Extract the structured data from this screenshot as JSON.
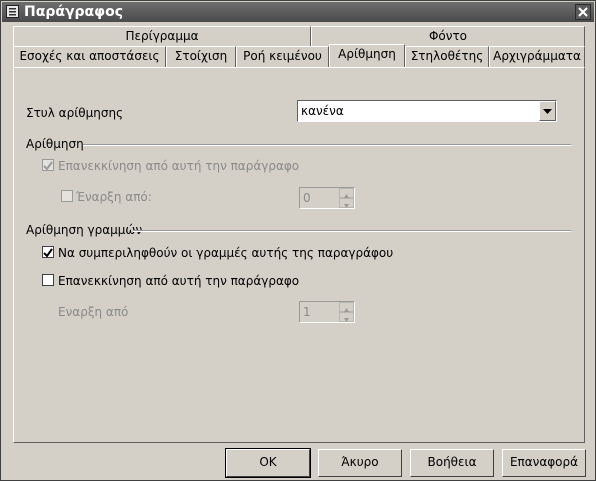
{
  "window": {
    "title": "Παράγραφος"
  },
  "tabs_row1": [
    "Περίγραμμα",
    "Φόντο"
  ],
  "tabs_row2": [
    "Εσοχές και αποστάσεις",
    "Στοίχιση",
    "Ροή κειμένου",
    "Αρίθμηση",
    "Στηλοθέτης",
    "Αρχιγράμματα"
  ],
  "numbering_style": {
    "label": "Στυλ αρίθμησης",
    "value": "κανένα"
  },
  "numbering_section": {
    "title": "Αρίθμηση",
    "restart_label": "Επανεκκίνηση από αυτή την παράγραφο",
    "start_label": "Έναρξη από:",
    "start_value": "0"
  },
  "line_numbering_section": {
    "title": "Αρίθμηση γραμμών",
    "include_label": "Να συμπεριληφθούν οι γραμμές αυτής της παραγράφου",
    "restart_label": "Επανεκκίνηση από αυτή την παράγραφο",
    "start_label": "Εναρξη από",
    "start_value": "1"
  },
  "buttons": {
    "ok": "OK",
    "cancel": "Άκυρο",
    "help": "Βοήθεια",
    "reset": "Επαναφορά"
  }
}
